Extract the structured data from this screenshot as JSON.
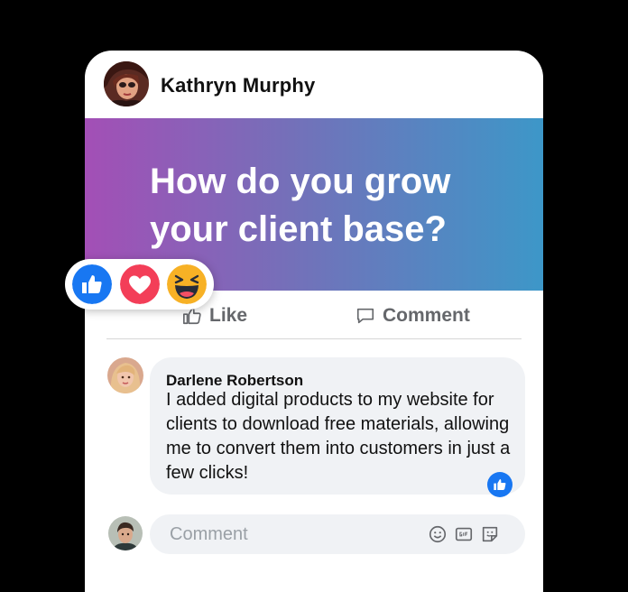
{
  "post": {
    "author_name": "Kathryn Murphy",
    "banner_text": "How do you grow your client base?"
  },
  "actions": {
    "like_label": "Like",
    "comment_label": "Comment"
  },
  "reactions": [
    "like-icon",
    "love-icon",
    "haha-icon"
  ],
  "comment": {
    "author": "Darlene Robertson",
    "text": "I added digital products to my website for clients to download free materials, allowing me to convert them into customers in just a few clicks!"
  },
  "composer": {
    "placeholder": "Comment",
    "icons": [
      "emoji-icon",
      "gif-icon",
      "sticker-icon"
    ]
  },
  "colors": {
    "banner_gradient": [
      "#a34fb6",
      "#3d97c8"
    ],
    "like_blue": "#1877f2",
    "love_red": "#f33e58",
    "haha_yellow": "#f7b125",
    "bubble_bg": "#f0f2f5"
  }
}
